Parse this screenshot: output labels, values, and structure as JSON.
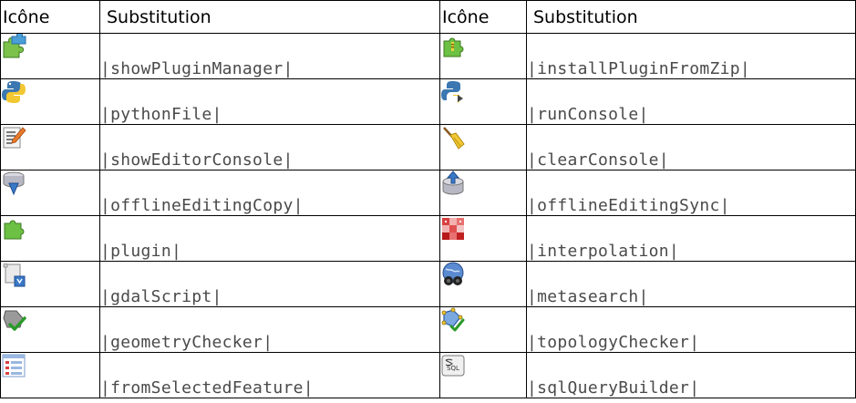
{
  "headers": {
    "icon": "Icône",
    "substitution": "Substitution"
  },
  "rows": [
    {
      "left": {
        "icon": "plugin-manager-icon",
        "substitution": "|showPluginManager|"
      },
      "right": {
        "icon": "install-plugin-zip-icon",
        "substitution": "|installPluginFromZip|"
      }
    },
    {
      "left": {
        "icon": "python-file-icon",
        "substitution": "|pythonFile|"
      },
      "right": {
        "icon": "python-console-icon",
        "substitution": "|runConsole|"
      }
    },
    {
      "left": {
        "icon": "editor-notepad-pencil-icon",
        "substitution": "|showEditorConsole|"
      },
      "right": {
        "icon": "broom-icon",
        "substitution": "|clearConsole|"
      }
    },
    {
      "left": {
        "icon": "offline-copy-database-icon",
        "substitution": "|offlineEditingCopy|"
      },
      "right": {
        "icon": "offline-sync-database-icon",
        "substitution": "|offlineEditingSync|"
      }
    },
    {
      "left": {
        "icon": "puzzle-piece-icon",
        "substitution": "|plugin|"
      },
      "right": {
        "icon": "interpolation-grid-icon",
        "substitution": "|interpolation|"
      }
    },
    {
      "left": {
        "icon": "gdal-script-icon",
        "substitution": "|gdalScript|"
      },
      "right": {
        "icon": "metasearch-globe-binoculars-icon",
        "substitution": "|metasearch|"
      }
    },
    {
      "left": {
        "icon": "geometry-checker-icon",
        "substitution": "|geometryChecker|"
      },
      "right": {
        "icon": "topology-checker-icon",
        "substitution": "|topologyChecker|"
      }
    },
    {
      "left": {
        "icon": "selected-feature-form-icon",
        "substitution": "|fromSelectedFeature|"
      },
      "right": {
        "icon": "sql-query-builder-icon",
        "substitution": "|sqlQueryBuilder|"
      }
    }
  ]
}
